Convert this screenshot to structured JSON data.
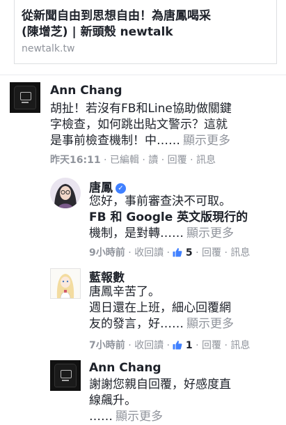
{
  "link_preview": {
    "title_line1": "從新聞自由到思想自由！為唐鳳喝采",
    "title_line2": "(陳增芝) | 新頭殼 newtalk",
    "domain": "newtalk.tw"
  },
  "comments": [
    {
      "author": "Ann Chang",
      "avatar_icon": "tshirt-avatar-icon",
      "lines": [
        "胡扯！若沒有FB和Line協助做關鍵",
        "字檢查，如何跳出貼文警示？這就",
        "是事前檢查機制！中……"
      ],
      "see_more": "顯示更多",
      "meta": {
        "time": "昨天16:11",
        "edited": "已編輯",
        "read": "讀",
        "reply": "回覆",
        "message": "訊息"
      }
    },
    {
      "author": "唐鳳",
      "verified": true,
      "avatar_icon": "portrait-avatar-icon",
      "lines": [
        "您好，事前審查決不可取。",
        "FB 和 Google 英文版現行的",
        "機制，是對轉……"
      ],
      "see_more": "顯示更多",
      "meta": {
        "time": "9小時前",
        "unread": "收回讀",
        "likes": "5",
        "reply": "回覆",
        "message": "訊息"
      }
    },
    {
      "author": "藍報數",
      "avatar_icon": "anime-avatar-icon",
      "lines": [
        "唐鳳辛苦了。",
        "週日還在上班，細心回覆網",
        "友的發言，好……"
      ],
      "see_more": "顯示更多",
      "meta": {
        "time": "7小時前",
        "unread": "收回讀",
        "likes": "1",
        "reply": "回覆",
        "message": "訊息"
      }
    },
    {
      "author": "Ann Chang",
      "avatar_icon": "tshirt-avatar-icon",
      "lines": [
        "謝謝您親自回覆，好感度直",
        "線飆升。",
        "……"
      ],
      "see_more": "顯示更多"
    }
  ],
  "colors": {
    "meta": "#90949c",
    "like_blue": "#4080ff",
    "text": "#1d2129"
  }
}
